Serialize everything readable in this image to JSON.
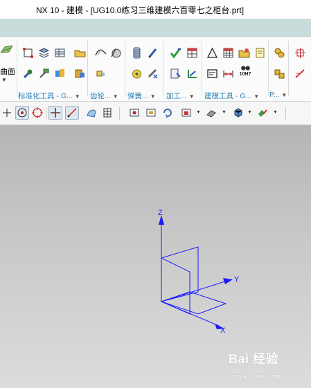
{
  "window": {
    "title": "NX 10 - 建模 - [UG10.0练习三维建模六百零七之柜台.prt]"
  },
  "ribbon": {
    "left_partial_label": "曲面",
    "groups": [
      {
        "label": "标准化工具 - G..."
      },
      {
        "label": "齿轮..."
      },
      {
        "label": "弹簧..."
      },
      {
        "label": "加工..."
      },
      {
        "label": "建模工具 - G..."
      },
      {
        "label": "P..."
      }
    ],
    "tolerance_icon_text": "10H7"
  },
  "viewport": {
    "axes": {
      "x": "X",
      "y": "Y",
      "z": "Z"
    },
    "triad_color": "#1a1aff",
    "background_top": "#b5b5b5",
    "background_bottom": "#dcdcdc"
  },
  "watermark": {
    "brand": "Bai 经验",
    "url": "jingyan.baidu.com"
  }
}
